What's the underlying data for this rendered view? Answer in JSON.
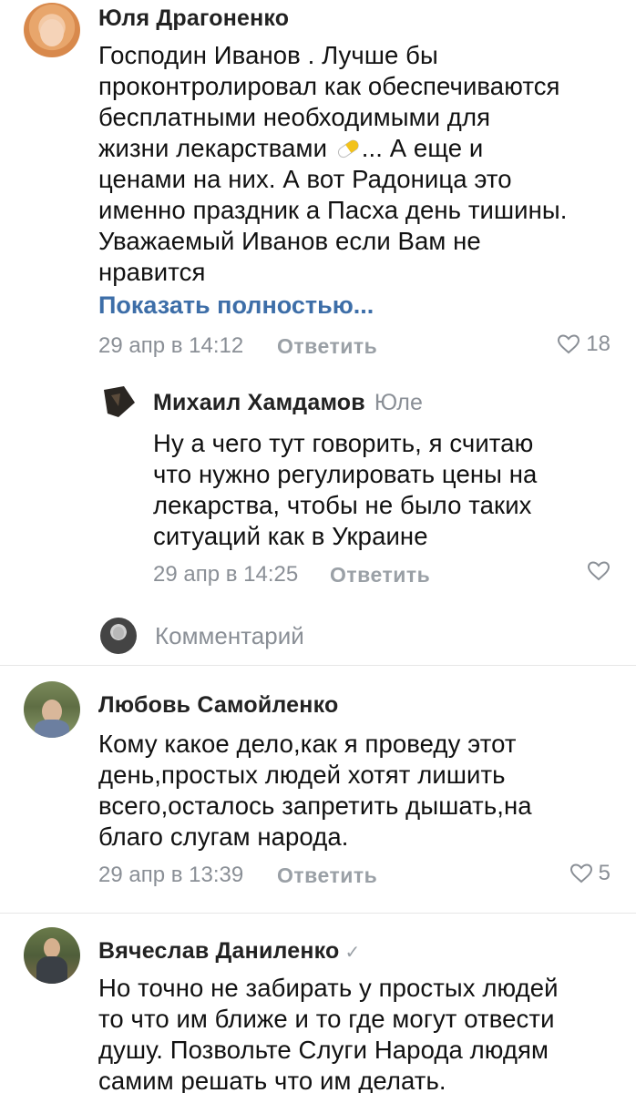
{
  "comments": [
    {
      "author": "Юля Драгоненко",
      "lines": [
        "Господин Иванов . Лучше бы",
        "проконтролировал как обеспечиваются",
        "бесплатными необходимыми для",
        "жизни  лекарствами",
        "ценами на них. А вот Радоница это",
        "именно праздник а Пасха день тишины.",
        "Уважаемый Иванов если Вам не",
        "нравится"
      ],
      "line4_suffix": "... А еще и",
      "show_more": "Показать полностью...",
      "date": "29 апр в 14:12",
      "reply_label": "Ответить",
      "likes": "18",
      "avatar_icon": "user-photo-icon"
    },
    {
      "author": "Михаил Хамдамов",
      "reply_to": "Юле",
      "lines": [
        "Ну а чего тут говорить, я считаю",
        "что нужно регулировать цены на",
        "лекарства, чтобы не было таких",
        "ситуаций как в Украине"
      ],
      "date": "29 апр в 14:25",
      "reply_label": "Ответить",
      "likes": "",
      "avatar_icon": "user-photo-icon"
    },
    {
      "author": "Любовь Самойленко",
      "lines": [
        "Кому какое дело,как я проведу этот",
        "день,простых людей хотят лишить",
        "всего,осталось запретить дышать,на",
        "благо слугам народа."
      ],
      "date": "29 апр в 13:39",
      "reply_label": "Ответить",
      "likes": "5",
      "avatar_icon": "user-photo-icon"
    },
    {
      "author": "Вячеслав Даниленко",
      "verified_icon": "verified-check-icon",
      "lines": [
        "Но точно не забирать у простых людей",
        "то что им ближе и то где могут отвести",
        "душу. Позвольте Слуги Народа людям",
        "самим решать что им делать."
      ],
      "avatar_icon": "user-photo-icon"
    }
  ],
  "compose": {
    "placeholder": "Комментарий"
  },
  "colors": {
    "link": "#3d6ea8",
    "muted": "#8a8f96",
    "divider": "#e6e6e6"
  }
}
